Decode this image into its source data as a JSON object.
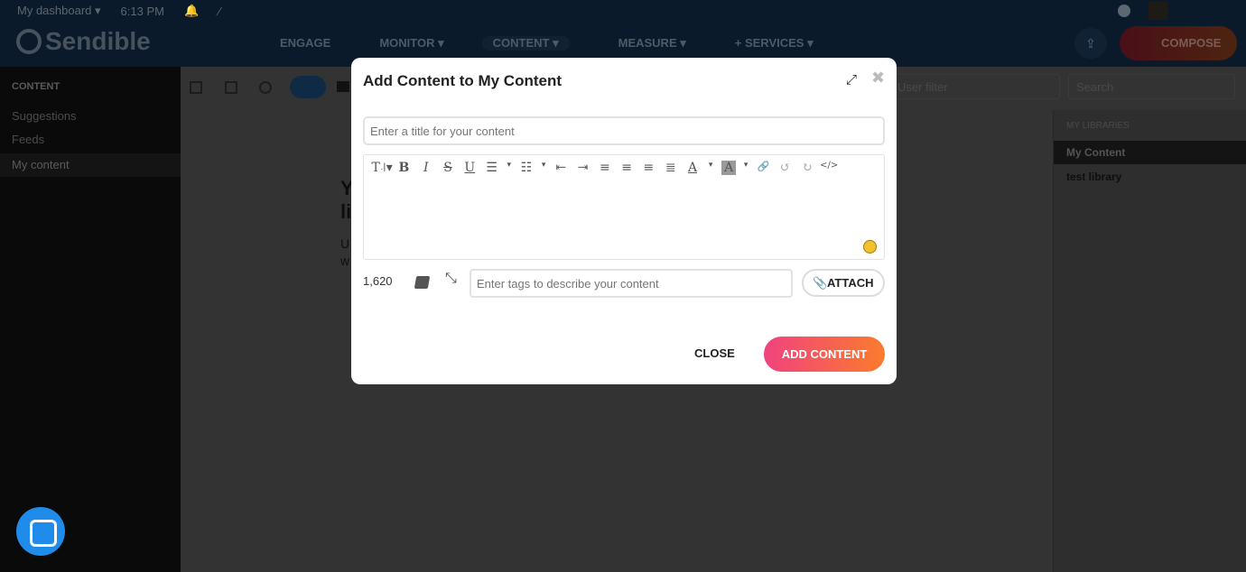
{
  "topbar": {
    "dashboard": "My dashboard ▾",
    "time": "6:13 PM",
    "brand": "Sendible",
    "nav": [
      "ENGAGE",
      "MONITOR ▾",
      "CONTENT ▾",
      "MEASURE ▾",
      "+ SERVICES ▾"
    ],
    "compose": "COMPOSE",
    "upload_icon": "⇪"
  },
  "sidebar": {
    "heading": "CONTENT",
    "items": [
      "Suggestions",
      "Feeds",
      "My content"
    ]
  },
  "main": {
    "fragments": [
      "Y",
      "li",
      "U",
      "w"
    ],
    "user_filter": "User filter",
    "search": "Search"
  },
  "libraries": {
    "heading": "MY LIBRARIES",
    "items": [
      "My Content",
      "test library"
    ]
  },
  "modal": {
    "title": "Add Content to My Content",
    "title_placeholder": "Enter a title for your content",
    "toolbar": [
      "T꜋▾",
      "B",
      "I",
      "S",
      "U",
      "☰",
      "▾",
      "☷",
      "▾",
      "⇤",
      "⇥",
      "≡",
      "≡",
      "≡",
      "≣",
      "A",
      "▾",
      "A",
      "▾",
      "🔗",
      "↺",
      "↻",
      "</>"
    ],
    "char_count": "1,620",
    "tags_placeholder": "Enter tags to describe your content",
    "attach": "ATTACH",
    "close": "CLOSE",
    "add": "ADD CONTENT"
  },
  "colors": {
    "accent_start": "#f0437e",
    "accent_end": "#fb7b2c",
    "chat": "#1f8ceb"
  }
}
